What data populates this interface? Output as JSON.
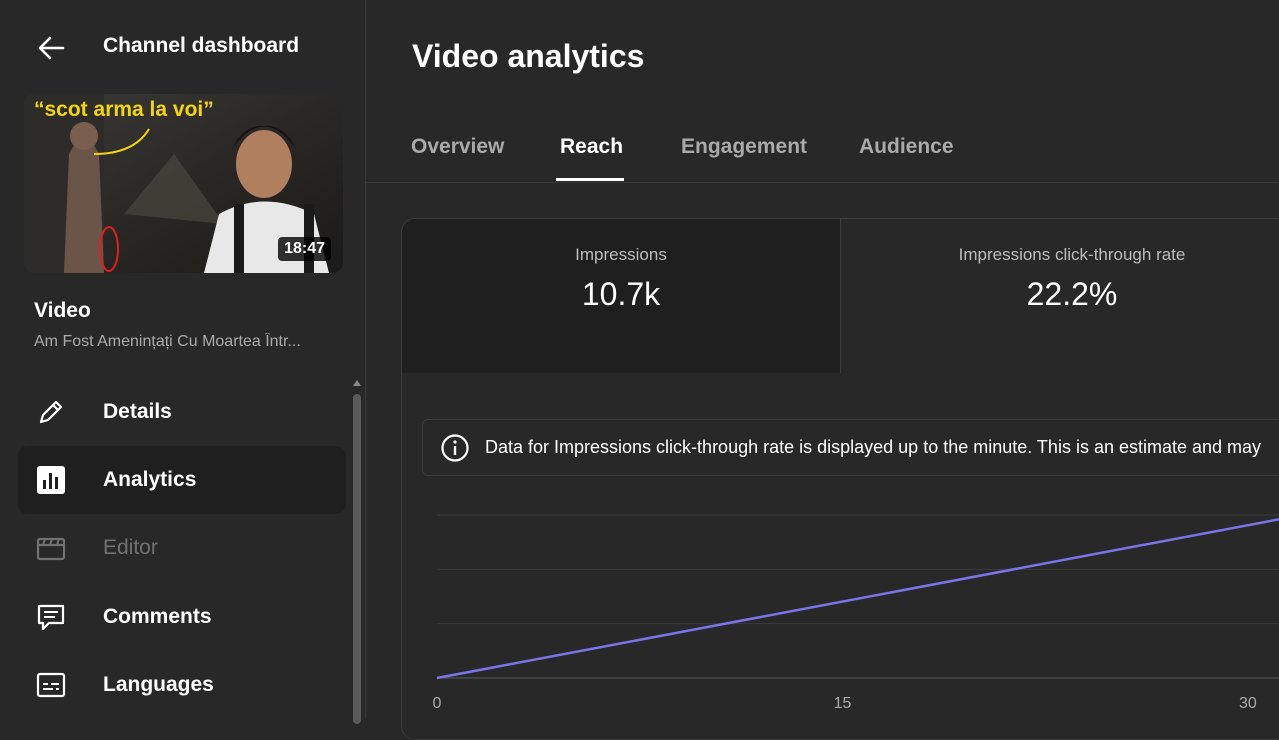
{
  "sidebar": {
    "header_title": "Channel dashboard",
    "thumbnail": {
      "caption": "“scot arma la voi”",
      "duration": "18:47"
    },
    "video_label": "Video",
    "video_title": "Am Fost Amenințați Cu Moartea Într...",
    "nav": [
      {
        "label": "Details",
        "icon": "pencil-icon",
        "state": "normal"
      },
      {
        "label": "Analytics",
        "icon": "analytics-icon",
        "state": "active"
      },
      {
        "label": "Editor",
        "icon": "clapperboard-icon",
        "state": "disabled"
      },
      {
        "label": "Comments",
        "icon": "comment-icon",
        "state": "normal"
      },
      {
        "label": "Languages",
        "icon": "subtitles-icon",
        "state": "normal"
      }
    ]
  },
  "main": {
    "page_title": "Video analytics",
    "tabs": [
      {
        "label": "Overview",
        "active": false
      },
      {
        "label": "Reach",
        "active": true
      },
      {
        "label": "Engagement",
        "active": false
      },
      {
        "label": "Audience",
        "active": false
      }
    ],
    "metrics": [
      {
        "label": "Impressions",
        "value": "10.7k",
        "selected": true
      },
      {
        "label": "Impressions click-through rate",
        "value": "22.2%",
        "selected": false
      }
    ],
    "info_banner": "Data for Impressions click-through rate is displayed up to the minute. This is an estimate and may"
  },
  "chart_data": {
    "type": "line",
    "x_ticks": [
      "0",
      "15",
      "30"
    ],
    "xlim": [
      0,
      32
    ],
    "series": [
      {
        "x": [
          0,
          32
        ],
        "y": [
          0,
          3
        ]
      }
    ],
    "ylim": [
      0,
      3
    ],
    "grid": true,
    "line_color": "#7b74e8"
  },
  "colors": {
    "accent_line": "#7b74e8",
    "caption_yellow": "#f5d60b"
  }
}
